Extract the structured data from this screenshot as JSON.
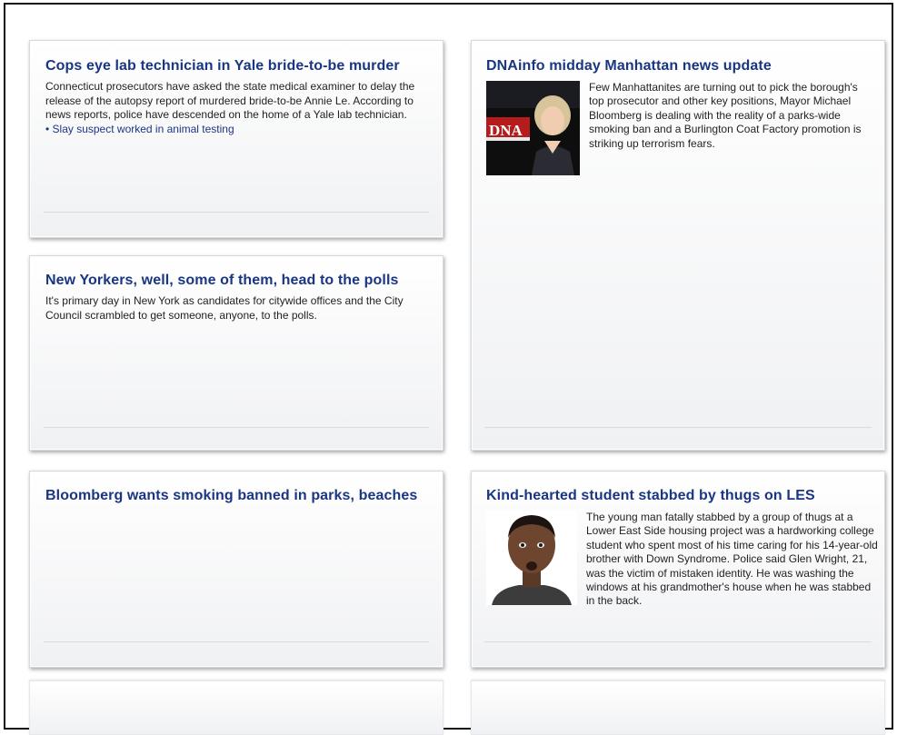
{
  "articles": [
    {
      "headline": "Cops eye lab technician in Yale bride-to-be murder",
      "body": "Connecticut prosecutors have asked the state medical examiner to delay the release of the autopsy report of murdered bride-to-be Annie Le. According to news reports, police have descended on the home of a Yale lab technician.",
      "related_link": "• Slay suspect worked in animal testing"
    },
    {
      "headline": "DNAinfo midday Manhattan news update",
      "body": "Few Manhattanites are turning out to pick the borough's top prosecutor and other key positions, Mayor Michael Bloomberg is dealing with the reality of a parks-wide smoking ban and a Burlington Coat Factory promotion is striking up terrorism fears.",
      "thumb_logo": "DNA"
    },
    {
      "headline": "New Yorkers, well, some of them, head to the polls",
      "body": "It's primary day in New York as candidates for citywide offices and the City Council scrambled to get someone, anyone, to the polls."
    },
    {
      "headline": "Bloomberg wants smoking banned in parks, beaches",
      "body": ""
    },
    {
      "headline": "Kind-hearted student stabbed by thugs on LES",
      "body": "The young man fatally stabbed by a group of thugs at a Lower East Side housing project was a hardworking college student who spent most of his time caring for his 14-year-old brother with Down Syndrome. Police said Glen Wright, 21, was the victim of mistaken identity. He was washing the windows at his grandmother's house when he was stabbed in the back."
    }
  ],
  "colors": {
    "headline": "#1a3683",
    "body_text": "#222222",
    "card_border": "#d6d9de",
    "frame_border": "#111111"
  }
}
